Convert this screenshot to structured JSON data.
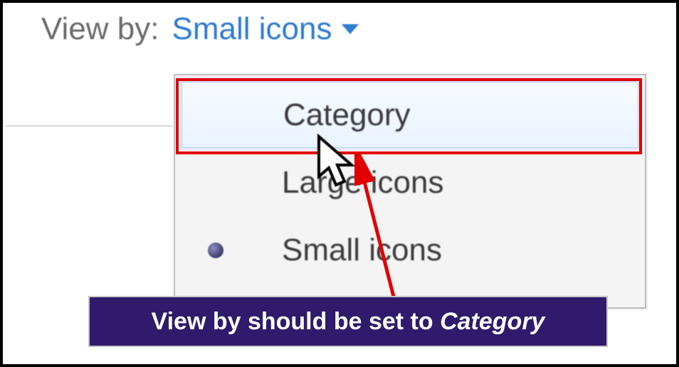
{
  "viewby": {
    "label": "View by:",
    "selected": "Small icons"
  },
  "menu": {
    "items": [
      {
        "label": "Category",
        "selected": false,
        "hovered": true
      },
      {
        "label": "Large icons",
        "selected": false,
        "hovered": false
      },
      {
        "label": "Small icons",
        "selected": true,
        "hovered": false
      }
    ]
  },
  "annotation": {
    "caption_prefix": "View by should be set to ",
    "caption_emphasis": "Category",
    "highlight_color": "#e10000",
    "caption_bg": "#2f1a6b"
  }
}
